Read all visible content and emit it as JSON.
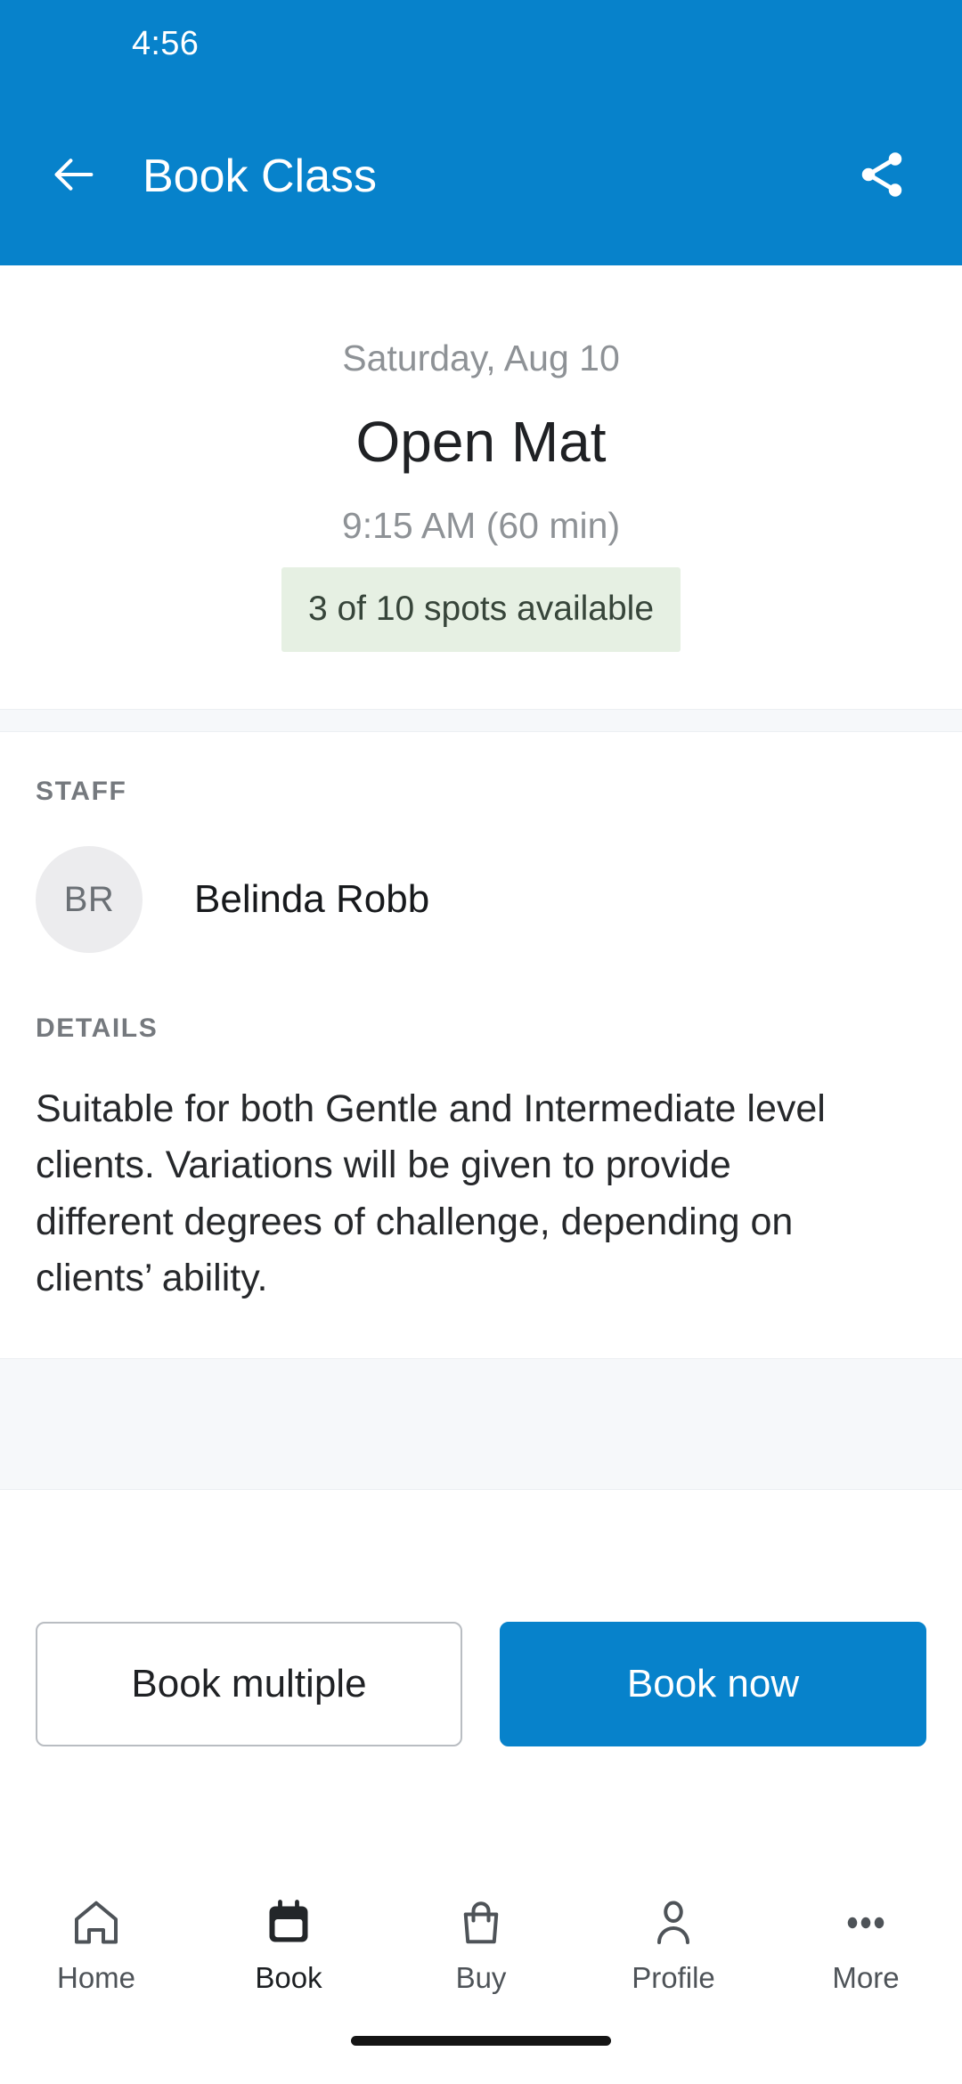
{
  "status_bar": {
    "time": "4:56"
  },
  "app_bar": {
    "title": "Book Class",
    "back_icon": "arrow-left-icon",
    "share_icon": "share-icon"
  },
  "class_summary": {
    "date": "Saturday, Aug 10",
    "name": "Open Mat",
    "time": "9:15 AM (60 min)",
    "availability": "3 of 10 spots available"
  },
  "staff_section": {
    "label": "STAFF",
    "members": [
      {
        "initials": "BR",
        "name": "Belinda Robb"
      }
    ]
  },
  "details_section": {
    "label": "DETAILS",
    "body": "Suitable for both Gentle and Intermediate level clients. Variations will be given to provide different degrees of challenge, depending on clients’ ability."
  },
  "actions": {
    "secondary_label": "Book multiple",
    "primary_label": "Book now"
  },
  "bottom_nav": {
    "items": [
      {
        "label": "Home",
        "icon": "home-icon",
        "active": false
      },
      {
        "label": "Book",
        "icon": "calendar-icon",
        "active": true
      },
      {
        "label": "Buy",
        "icon": "bag-icon",
        "active": false
      },
      {
        "label": "Profile",
        "icon": "person-icon",
        "active": false
      },
      {
        "label": "More",
        "icon": "dots-icon",
        "active": false
      }
    ]
  },
  "colors": {
    "brand_blue": "#0782cb",
    "badge_green_bg": "#e6f0e3",
    "badge_green_text": "#37453a",
    "band_grey": "#f6f8fa",
    "muted_text": "#8e9296",
    "avatar_bg": "#ececee"
  }
}
